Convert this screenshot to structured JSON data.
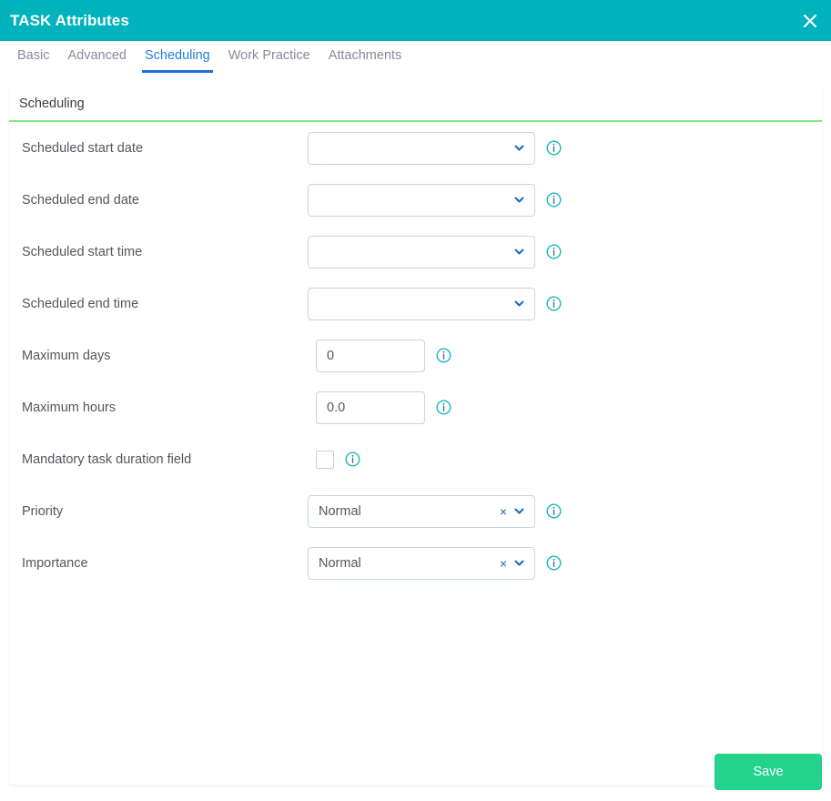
{
  "window": {
    "title": "TASK Attributes",
    "close_icon": "close-icon",
    "accent_teal": "#00b3bd",
    "accent_green": "#22d38c",
    "tab_active_blue": "#1a73d4",
    "divider_green": "#7ee787"
  },
  "tabs": [
    {
      "label": "Basic",
      "active": false
    },
    {
      "label": "Advanced",
      "active": false
    },
    {
      "label": "Scheduling",
      "active": true
    },
    {
      "label": "Work Practice",
      "active": false
    },
    {
      "label": "Attachments",
      "active": false
    }
  ],
  "section": {
    "title": "Scheduling"
  },
  "fields": [
    {
      "label": "Scheduled start date",
      "type": "select",
      "value": "",
      "clearable": false,
      "info_icon": "info-icon"
    },
    {
      "label": "Scheduled end date",
      "type": "select",
      "value": "",
      "clearable": false,
      "info_icon": "info-icon"
    },
    {
      "label": "Scheduled start time",
      "type": "select",
      "value": "",
      "clearable": false,
      "info_icon": "info-icon"
    },
    {
      "label": "Scheduled end time",
      "type": "select",
      "value": "",
      "clearable": false,
      "info_icon": "info-icon"
    },
    {
      "label": "Maximum days",
      "type": "text",
      "value": "0",
      "info_icon": "info-icon"
    },
    {
      "label": "Maximum hours",
      "type": "text",
      "value": "0.0",
      "info_icon": "info-icon"
    },
    {
      "label": "Mandatory task duration field",
      "type": "checkbox",
      "checked": false,
      "info_icon": "info-icon"
    },
    {
      "label": "Priority",
      "type": "select",
      "value": "Normal",
      "clearable": true,
      "clear_glyph": "×",
      "info_icon": "info-icon"
    },
    {
      "label": "Importance",
      "type": "select",
      "value": "Normal",
      "clearable": true,
      "clear_glyph": "×",
      "info_icon": "info-icon"
    }
  ],
  "footer": {
    "save_label": "Save"
  }
}
